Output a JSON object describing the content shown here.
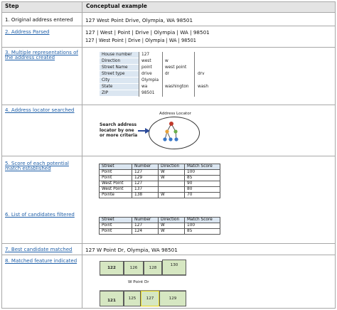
{
  "header": {
    "step": "Step",
    "example": "Conceptual example"
  },
  "steps": [
    {
      "label": "1. Original address entered"
    },
    {
      "label": "2. Address Parsed"
    },
    {
      "label": "3. Multiple representations of"
    },
    {
      "label": "the address created"
    },
    {
      "label": "4. Address locator searched"
    },
    {
      "label": "5. Score of each potential"
    },
    {
      "label": "match established"
    },
    {
      "label": "6. List of candidates filtered"
    },
    {
      "label": "7. Best candidate matched"
    },
    {
      "label": "8. Matched feature indicated"
    }
  ],
  "examples": {
    "original": "127 West Point Drive, Olympia, WA 98501",
    "parsed_1": "127 | West | Point | Drive | Olympia | WA | 98501",
    "parsed_2": "127 | West Point | Drive | Olympia | WA | 98501",
    "best": "127 W Point Dr, Olympia, WA 98501"
  },
  "representations": [
    {
      "label": "House number",
      "v1": "127",
      "v2": "",
      "v3": ""
    },
    {
      "label": "Direction",
      "v1": "west",
      "v2": "w",
      "v3": ""
    },
    {
      "label": "Street Name",
      "v1": "point",
      "v2": "west point",
      "v3": ""
    },
    {
      "label": "Street type",
      "v1": "drive",
      "v2": "dr",
      "v3": "drv"
    },
    {
      "label": "City",
      "v1": "Olympia",
      "v2": "",
      "v3": ""
    },
    {
      "label": "State",
      "v1": "wa",
      "v2": "washington",
      "v3": "wash"
    },
    {
      "label": "ZIP",
      "v1": "98501",
      "v2": "",
      "v3": ""
    }
  ],
  "locator": {
    "title": "Address Locator",
    "search_1": "Search address",
    "search_2": "locator by one",
    "search_3": "or more criteria"
  },
  "score_table": {
    "headers": [
      "Street",
      "Number",
      "Direction",
      "Match Score"
    ],
    "rows": [
      [
        "Point",
        "127",
        "W",
        "100"
      ],
      [
        "Point",
        "129",
        "W",
        "85"
      ],
      [
        "West Point",
        "127",
        "",
        "90"
      ],
      [
        "West Point",
        "137",
        "",
        "80"
      ],
      [
        "Pointe",
        "138",
        "W",
        "70"
      ]
    ]
  },
  "filter_table": {
    "headers": [
      "Street",
      "Number",
      "Direction",
      "Match Score"
    ],
    "rows": [
      [
        "Point",
        "127",
        "W",
        "100"
      ],
      [
        "Point",
        "124",
        "W",
        "85"
      ]
    ]
  },
  "map": {
    "road": "W Point Dr",
    "top_parcels": [
      "122",
      "126",
      "128",
      "130"
    ],
    "bottom_parcels": [
      "121",
      "125",
      "127",
      "129"
    ]
  }
}
